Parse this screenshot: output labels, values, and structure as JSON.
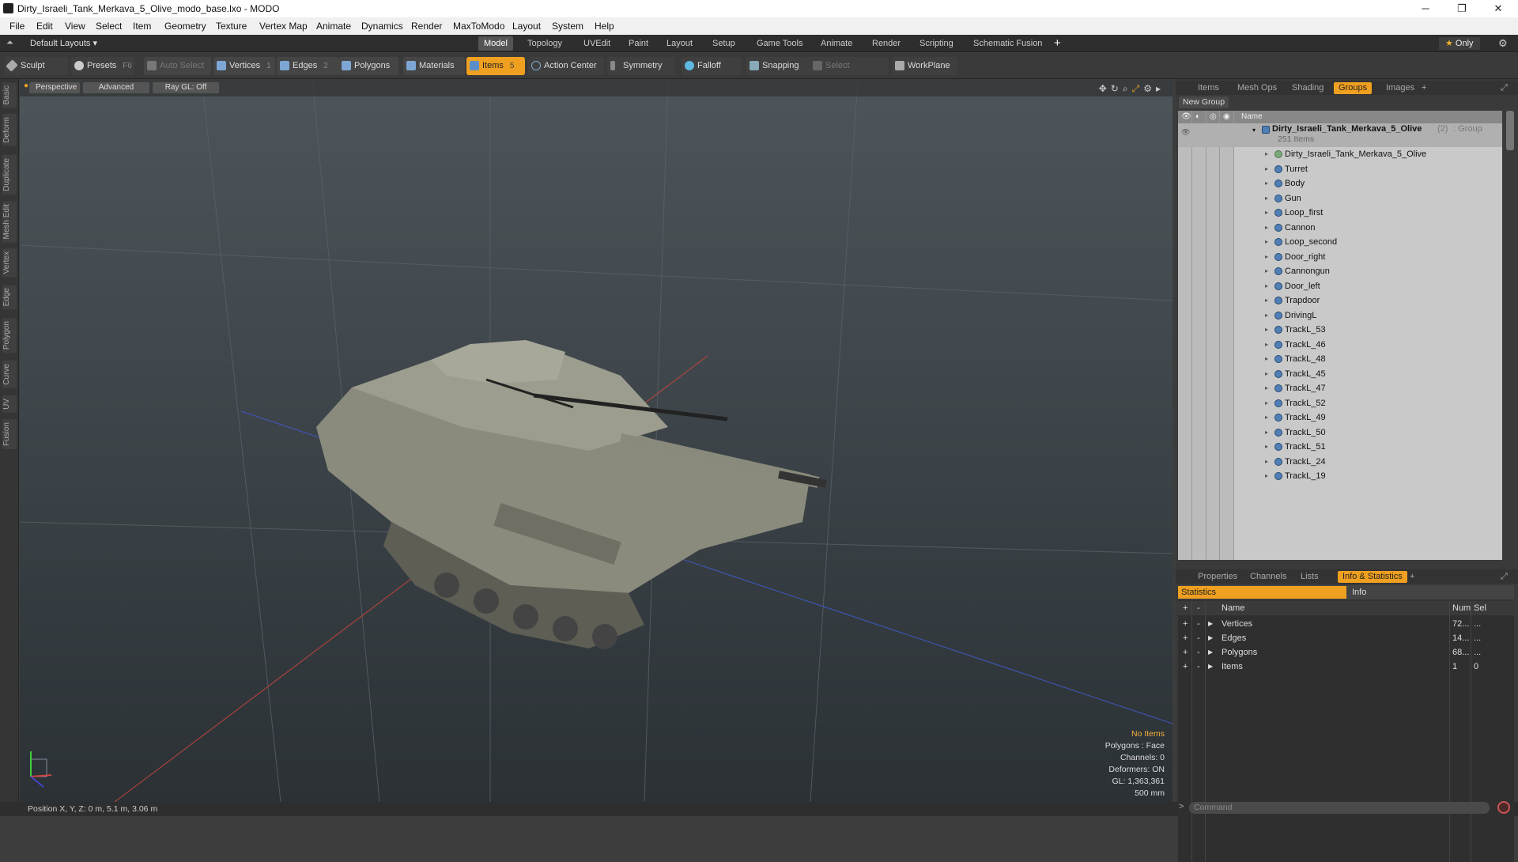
{
  "window": {
    "title": "Dirty_Israeli_Tank_Merkava_5_Olive_modo_base.lxo - MODO"
  },
  "menu": [
    "File",
    "Edit",
    "View",
    "Select",
    "Item",
    "Geometry",
    "Texture",
    "Vertex Map",
    "Animate",
    "Dynamics",
    "Render",
    "MaxToModo",
    "Layout",
    "System",
    "Help"
  ],
  "layouts": {
    "label": "Default Layouts ▾",
    "only": "Only",
    "tabs": [
      "Model",
      "Topology",
      "UVEdit",
      "Paint",
      "Layout",
      "Setup",
      "Game Tools",
      "Animate",
      "Render",
      "Scripting",
      "Schematic Fusion"
    ],
    "active": "Model"
  },
  "toolbar": {
    "sculpt": "Sculpt",
    "presets": "Presets",
    "presets_key": "F6",
    "auto_select": "Auto Select",
    "vertices": "Vertices",
    "vertices_key": "1",
    "edges": "Edges",
    "edges_key": "2",
    "polygons": "Polygons",
    "materials": "Materials",
    "items": "Items",
    "items_key": "5",
    "action_center": "Action Center",
    "symmetry": "Symmetry",
    "falloff": "Falloff",
    "snapping": "Snapping",
    "select_through": "Select Through",
    "workplane": "WorkPlane"
  },
  "left_tabs": [
    "Basic",
    "Deform",
    "Duplicate",
    "Mesh Edit",
    "Vertex",
    "Edge",
    "Polygon",
    "Curve",
    "UV",
    "Fusion"
  ],
  "viewport": {
    "perspective": "Perspective",
    "advanced": "Advanced",
    "raygl": "Ray GL: Off",
    "info": {
      "no_items": "No Items",
      "polygons": "Polygons : Face",
      "channels": "Channels: 0",
      "deformers": "Deformers: ON",
      "gl": "GL: 1,363,361",
      "scale": "500 mm"
    }
  },
  "status": {
    "position": "Position X, Y, Z:  0 m, 5.1 m, 3.06 m"
  },
  "items_panel": {
    "tabs": [
      "Items",
      "Mesh Ops",
      "Shading",
      "Groups",
      "Images"
    ],
    "active": "Groups",
    "new_group": "New Group",
    "name_header": "Name",
    "group": {
      "name": "Dirty_Israeli_Tank_Merkava_5_Olive",
      "count": "(2)",
      "type": ": Group",
      "items": "251 Items"
    },
    "rows": [
      "Dirty_Israeli_Tank_Merkava_5_Olive",
      "Turret",
      "Body",
      "Gun",
      "Loop_first",
      "Cannon",
      "Loop_second",
      "Door_right",
      "Cannongun",
      "Door_left",
      "Trapdoor",
      "DrivingL",
      "TrackL_53",
      "TrackL_46",
      "TrackL_48",
      "TrackL_45",
      "TrackL_47",
      "TrackL_52",
      "TrackL_49",
      "TrackL_50",
      "TrackL_51",
      "TrackL_24",
      "TrackL_19"
    ]
  },
  "props_panel": {
    "tabs": [
      "Properties",
      "Channels",
      "Lists",
      "Info & Statistics"
    ],
    "active": "Info & Statistics",
    "statistics": "Statistics",
    "info": "Info",
    "columns": {
      "name": "Name",
      "num": "Num",
      "sel": "Sel"
    },
    "rows": [
      {
        "name": "Vertices",
        "num": "72...",
        "sel": "..."
      },
      {
        "name": "Edges",
        "num": "14...",
        "sel": "..."
      },
      {
        "name": "Polygons",
        "num": "68...",
        "sel": "..."
      },
      {
        "name": "Items",
        "num": "1",
        "sel": "0"
      }
    ]
  },
  "command": {
    "placeholder": "Command"
  }
}
